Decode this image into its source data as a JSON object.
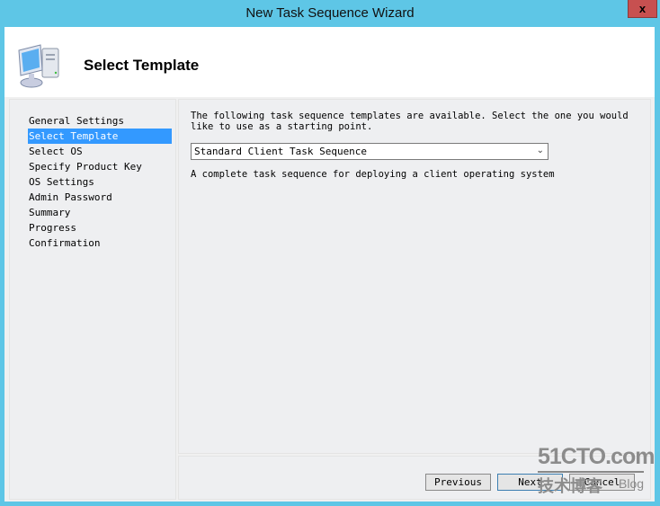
{
  "window": {
    "title": "New Task Sequence Wizard",
    "close_label": "x"
  },
  "header": {
    "title": "Select Template",
    "icon": "computer-icon"
  },
  "sidebar": {
    "items": [
      {
        "label": "General Settings",
        "active": false
      },
      {
        "label": "Select Template",
        "active": true
      },
      {
        "label": "Select OS",
        "active": false
      },
      {
        "label": "Specify Product Key",
        "active": false
      },
      {
        "label": "OS Settings",
        "active": false
      },
      {
        "label": "Admin Password",
        "active": false
      },
      {
        "label": "Summary",
        "active": false
      },
      {
        "label": "Progress",
        "active": false
      },
      {
        "label": "Confirmation",
        "active": false
      }
    ]
  },
  "main": {
    "intro": "The following task sequence templates are available.  Select the one you would like to use as a starting point.",
    "template_select": {
      "value": "Standard Client Task Sequence",
      "arrow_icon": "chevron-down-icon"
    },
    "description": "A complete task sequence for deploying a client operating system"
  },
  "footer": {
    "previous_label": "Previous",
    "next_label": "Next",
    "cancel_label": "Cancel"
  },
  "watermark": {
    "top": "51CTO.com",
    "bottom": "技术博客",
    "blog": "Blog"
  },
  "colors": {
    "frame": "#5ec6e6",
    "selection": "#3399ff",
    "close": "#c75050"
  }
}
